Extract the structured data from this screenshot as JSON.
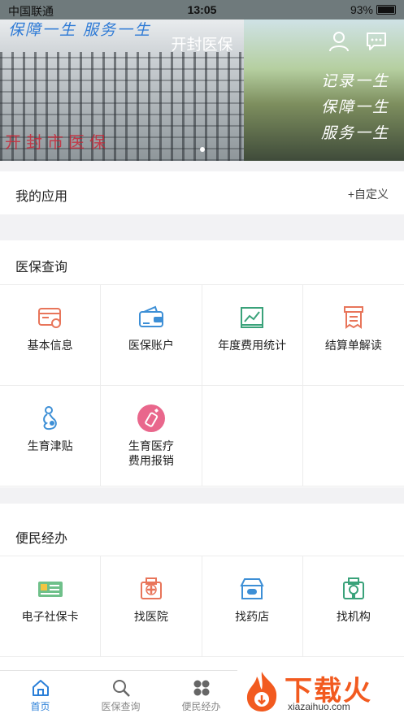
{
  "status": {
    "carrier": "中国联通",
    "time": "13:05",
    "battery": "93%",
    "battery_level": 0.93
  },
  "header": {
    "title": "开封医保",
    "slogan_top": "保障一生 服务一生",
    "slogan_right": [
      "记录一生",
      "保障一生",
      "服务一生"
    ],
    "banner_sign": "开封市医保"
  },
  "my_apps": {
    "title": "我的应用",
    "customize": "+自定义"
  },
  "query": {
    "title": "医保查询",
    "items": [
      {
        "label": "基本信息",
        "icon": "id-card-icon",
        "color": "#e8755a"
      },
      {
        "label": "医保账户",
        "icon": "wallet-icon",
        "color": "#3d8fd6"
      },
      {
        "label": "年度费用统计",
        "icon": "line-chart-icon",
        "color": "#3aa27a"
      },
      {
        "label": "结算单解读",
        "icon": "receipt-icon",
        "color": "#e8755a"
      },
      {
        "label": "生育津贴",
        "icon": "pregnancy-icon",
        "color": "#3d8fd6"
      },
      {
        "label": "生育医疗\n费用报销",
        "icon": "baby-bottle-icon",
        "color": "#e9678c"
      }
    ]
  },
  "services": {
    "title": "便民经办",
    "items": [
      {
        "label": "电子社保卡",
        "icon": "social-card-icon",
        "color": "#3aa27a"
      },
      {
        "label": "找医院",
        "icon": "hospital-icon",
        "color": "#e8755a"
      },
      {
        "label": "找药店",
        "icon": "pharmacy-icon",
        "color": "#3d8fd6"
      },
      {
        "label": "找机构",
        "icon": "institution-icon",
        "color": "#3aa27a"
      }
    ]
  },
  "tabs": [
    {
      "label": "首页",
      "icon": "home-icon",
      "active": true
    },
    {
      "label": "医保查询",
      "icon": "search-icon",
      "active": false
    },
    {
      "label": "便民经办",
      "icon": "grid-icon",
      "active": false
    }
  ],
  "watermark": {
    "brand": "下载火",
    "url": "xiazaihuo.com"
  },
  "colors": {
    "accent": "#2a7fd8",
    "watermark": "#f25a1f"
  }
}
